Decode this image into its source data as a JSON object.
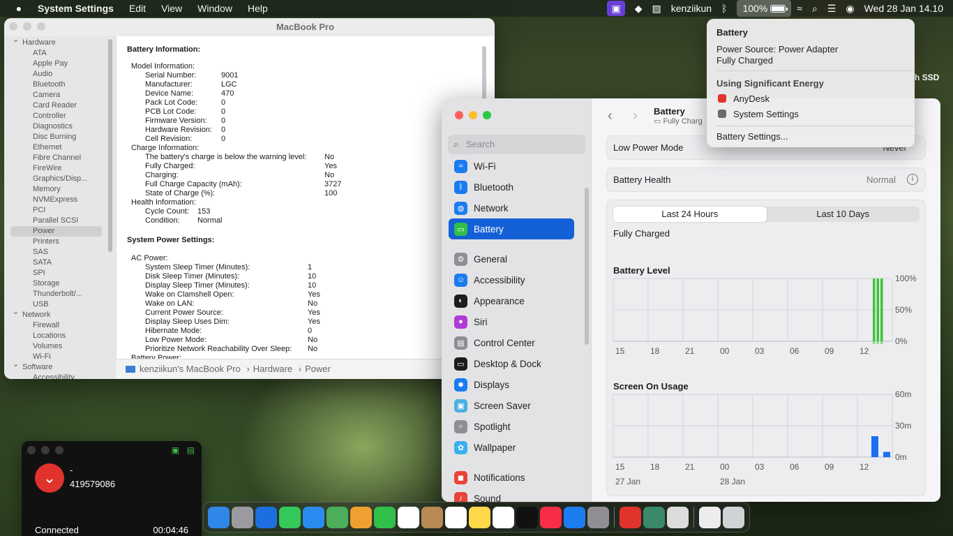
{
  "menubar": {
    "app_name": "System Settings",
    "menus": [
      "Edit",
      "View",
      "Window",
      "Help"
    ],
    "user": "kenziikun",
    "battery_percent": "100%",
    "datetime": "Wed 28 Jan  14.10"
  },
  "desktop": {
    "disk_label": "h SSD"
  },
  "sysinfo": {
    "title": "MacBook Pro",
    "sidebar": [
      {
        "type": "group",
        "label": "Hardware"
      },
      {
        "label": "ATA"
      },
      {
        "label": "Apple Pay"
      },
      {
        "label": "Audio"
      },
      {
        "label": "Bluetooth"
      },
      {
        "label": "Camera"
      },
      {
        "label": "Card Reader"
      },
      {
        "label": "Controller"
      },
      {
        "label": "Diagnostics"
      },
      {
        "label": "Disc Burning"
      },
      {
        "label": "Ethernet"
      },
      {
        "label": "Fibre Channel"
      },
      {
        "label": "FireWire"
      },
      {
        "label": "Graphics/Disp..."
      },
      {
        "label": "Memory"
      },
      {
        "label": "NVMExpress"
      },
      {
        "label": "PCI"
      },
      {
        "label": "Parallel SCSI"
      },
      {
        "label": "Power",
        "selected": true
      },
      {
        "label": "Printers"
      },
      {
        "label": "SAS"
      },
      {
        "label": "SATA"
      },
      {
        "label": "SPI"
      },
      {
        "label": "Storage"
      },
      {
        "label": "Thunderbolt/..."
      },
      {
        "label": "USB"
      },
      {
        "type": "group",
        "label": "Network"
      },
      {
        "label": "Firewall"
      },
      {
        "label": "Locations"
      },
      {
        "label": "Volumes"
      },
      {
        "label": "Wi-Fi"
      },
      {
        "type": "group",
        "label": "Software"
      },
      {
        "label": "Accessibility"
      }
    ],
    "battery_heading": "Battery Information:",
    "battery_rows": [
      {
        "k": "Model Information:",
        "v": "",
        "lvl": 0
      },
      {
        "k": "Serial Number:",
        "v": "9001",
        "lvl": 1
      },
      {
        "k": "Manufacturer:",
        "v": "LGC",
        "lvl": 1
      },
      {
        "k": "Device Name:",
        "v": "470",
        "lvl": 1
      },
      {
        "k": "Pack Lot Code:",
        "v": "0",
        "lvl": 1
      },
      {
        "k": "PCB Lot Code:",
        "v": "0",
        "lvl": 1
      },
      {
        "k": "Firmware Version:",
        "v": "0",
        "lvl": 1
      },
      {
        "k": "Hardware Revision:",
        "v": "0",
        "lvl": 1
      },
      {
        "k": "Cell Revision:",
        "v": "0",
        "lvl": 1
      },
      {
        "k": "Charge Information:",
        "v": "",
        "lvl": 0
      },
      {
        "k": "The battery's charge is below the warning level:",
        "v": "No",
        "lvl": 2
      },
      {
        "k": "Fully Charged:",
        "v": "Yes",
        "lvl": 2
      },
      {
        "k": "Charging:",
        "v": "No",
        "lvl": 2
      },
      {
        "k": "Full Charge Capacity (mAh):",
        "v": "3727",
        "lvl": 2
      },
      {
        "k": "State of Charge (%):",
        "v": "100",
        "lvl": 2
      },
      {
        "k": "Health Information:",
        "v": "",
        "lvl": 0
      },
      {
        "k": "Cycle Count:",
        "v": "153",
        "lvl": 3
      },
      {
        "k": "Condition:",
        "v": "Normal",
        "lvl": 3
      }
    ],
    "power_heading": "System Power Settings:",
    "power_rows": [
      {
        "k": "AC Power:",
        "v": "",
        "lvl": 0
      },
      {
        "k": "System Sleep Timer (Minutes):",
        "v": "1",
        "lvl": 4
      },
      {
        "k": "Disk Sleep Timer (Minutes):",
        "v": "10",
        "lvl": 4
      },
      {
        "k": "Display Sleep Timer (Minutes):",
        "v": "10",
        "lvl": 4
      },
      {
        "k": "Wake on Clamshell Open:",
        "v": "Yes",
        "lvl": 4
      },
      {
        "k": "Wake on LAN:",
        "v": "No",
        "lvl": 4
      },
      {
        "k": "Current Power Source:",
        "v": "Yes",
        "lvl": 4
      },
      {
        "k": "Display Sleep Uses Dim:",
        "v": "Yes",
        "lvl": 4
      },
      {
        "k": "Hibernate Mode:",
        "v": "0",
        "lvl": 4
      },
      {
        "k": "Low Power Mode:",
        "v": "No",
        "lvl": 4
      },
      {
        "k": "Prioritize Network Reachability Over Sleep:",
        "v": "No",
        "lvl": 4
      },
      {
        "k": "Battery Power:",
        "v": "",
        "lvl": 0
      }
    ],
    "path": [
      "kenziikun's MacBook Pro",
      "Hardware",
      "Power"
    ]
  },
  "settings": {
    "search_placeholder": "Search",
    "nav": [
      {
        "label": "Wi-Fi",
        "icon": "wifi-icon",
        "color": "#1a7cf0",
        "glyph": "≈"
      },
      {
        "label": "Bluetooth",
        "icon": "bluetooth-icon",
        "color": "#1a7cf0",
        "glyph": "ᛒ"
      },
      {
        "label": "Network",
        "icon": "network-icon",
        "color": "#1a7cf0",
        "glyph": "◍"
      },
      {
        "label": "Battery",
        "icon": "battery-icon",
        "color": "#30c04a",
        "glyph": "▭",
        "selected": true
      },
      {
        "label": "General",
        "icon": "gear-icon",
        "color": "#8e8e93",
        "glyph": "⚙"
      },
      {
        "label": "Accessibility",
        "icon": "accessibility-icon",
        "color": "#1a7cf0",
        "glyph": "☺"
      },
      {
        "label": "Appearance",
        "icon": "appearance-icon",
        "color": "#1c1c1e",
        "glyph": "◐"
      },
      {
        "label": "Siri",
        "icon": "siri-icon",
        "color": "#b03ad6",
        "glyph": "●"
      },
      {
        "label": "Control Center",
        "icon": "control-center-icon",
        "color": "#8e8e93",
        "glyph": "▤"
      },
      {
        "label": "Desktop & Dock",
        "icon": "dock-icon",
        "color": "#1c1c1e",
        "glyph": "▭"
      },
      {
        "label": "Displays",
        "icon": "displays-icon",
        "color": "#1a7cf0",
        "glyph": "✹"
      },
      {
        "label": "Screen Saver",
        "icon": "screen-saver-icon",
        "color": "#4ab0e0",
        "glyph": "▣"
      },
      {
        "label": "Spotlight",
        "icon": "spotlight-icon",
        "color": "#8e8e93",
        "glyph": "⌕"
      },
      {
        "label": "Wallpaper",
        "icon": "wallpaper-icon",
        "color": "#3ab0f0",
        "glyph": "✿"
      },
      {
        "label": "Notifications",
        "icon": "notifications-icon",
        "color": "#e8443a",
        "glyph": "◼"
      },
      {
        "label": "Sound",
        "icon": "sound-icon",
        "color": "#e8443a",
        "glyph": "♪"
      }
    ],
    "header_title": "Battery",
    "header_sub": "Fully Charg",
    "low_power_label": "Low Power Mode",
    "low_power_value": "Never",
    "health_label": "Battery Health",
    "health_value": "Normal",
    "seg_24": "Last 24 Hours",
    "seg_10": "Last 10 Days",
    "status_text": "Fully Charged",
    "battery_chart_title": "Battery Level",
    "usage_chart_title": "Screen On Usage"
  },
  "chart_data": [
    {
      "type": "bar",
      "title": "Battery Level",
      "x_tick_labels": [
        "15",
        "18",
        "21",
        "00",
        "03",
        "06",
        "09",
        "12"
      ],
      "y_tick_labels": [
        "100%",
        "50%",
        "0%"
      ],
      "ylim": [
        0,
        100
      ],
      "series": [
        {
          "values": [
            100,
            100,
            100
          ]
        }
      ]
    },
    {
      "type": "bar",
      "title": "Screen On Usage",
      "x_tick_labels": [
        "15",
        "18",
        "21",
        "00",
        "03",
        "06",
        "09",
        "12"
      ],
      "date_labels": [
        "27 Jan",
        "28 Jan"
      ],
      "y_tick_labels": [
        "60m",
        "30m",
        "0m"
      ],
      "ylim": [
        0,
        60
      ],
      "series": [
        {
          "values": [
            20,
            5
          ]
        }
      ]
    }
  ],
  "popover": {
    "title": "Battery",
    "power_source": "Power Source: Power Adapter",
    "charge_state": "Fully Charged",
    "energy_heading": "Using Significant Energy",
    "apps": [
      {
        "label": "AnyDesk",
        "icon": "anydesk-icon",
        "color": "#e1332c"
      },
      {
        "label": "System Settings",
        "icon": "settings-icon",
        "color": "#6b6b6b"
      }
    ],
    "settings_link": "Battery Settings..."
  },
  "anydesk": {
    "name": "-",
    "id": "419579086",
    "status": "Connected",
    "timer": "00:04:46"
  },
  "dock": [
    {
      "icon": "finder-icon",
      "color": "#2f87e8"
    },
    {
      "icon": "launchpad-icon",
      "color": "#9a9aa0"
    },
    {
      "icon": "safari-icon",
      "color": "#1d6ee0"
    },
    {
      "icon": "messages-icon",
      "color": "#34c759"
    },
    {
      "icon": "mail-icon",
      "color": "#2a8cf0"
    },
    {
      "icon": "maps-icon",
      "color": "#4cae5a"
    },
    {
      "icon": "photos-icon",
      "color": "#f0a030"
    },
    {
      "icon": "facetime-icon",
      "color": "#30c04a"
    },
    {
      "icon": "calendar-icon",
      "color": "#ffffff"
    },
    {
      "icon": "contacts-icon",
      "color": "#b88a54"
    },
    {
      "icon": "reminders-icon",
      "color": "#ffffff"
    },
    {
      "icon": "notes-icon",
      "color": "#ffd84a"
    },
    {
      "icon": "freeform-icon",
      "color": "#ffffff"
    },
    {
      "icon": "tv-icon",
      "color": "#111111"
    },
    {
      "icon": "music-icon",
      "color": "#fa2d48"
    },
    {
      "icon": "app-store-icon",
      "color": "#1d7cf0"
    },
    {
      "icon": "system-settings-icon",
      "color": "#8e8e93"
    },
    {
      "icon": "anydesk-dock-icon",
      "color": "#e1332c"
    },
    {
      "icon": "system-information-icon",
      "color": "#3a8a6a"
    },
    {
      "icon": "printer-icon",
      "color": "#dcdcdc"
    },
    {
      "icon": "downloads-icon",
      "color": "#ececec"
    },
    {
      "icon": "trash-icon",
      "color": "#cfd3d6"
    }
  ]
}
